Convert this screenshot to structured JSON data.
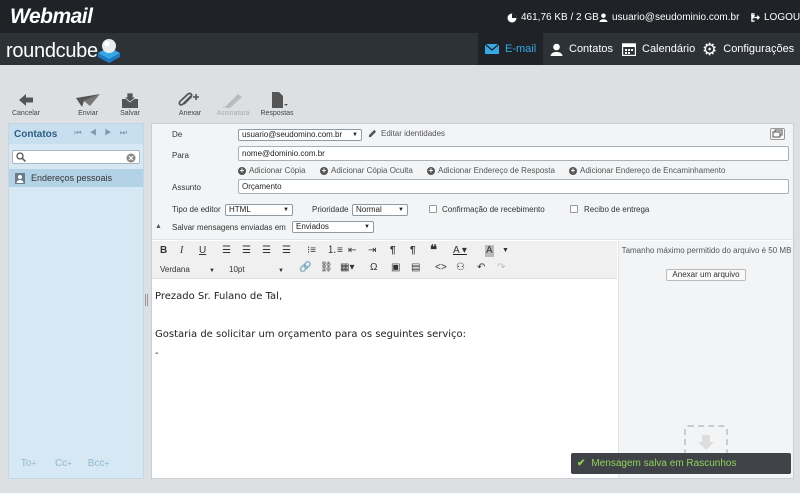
{
  "top": {
    "brand": "Webmail",
    "quota": "461,76 KB / 2 GB",
    "user": "usuario@seudominio.com.br",
    "logout": "LOGOUT"
  },
  "nav": {
    "logo": "roundcube",
    "items": [
      {
        "label": "E-mail",
        "icon": "envelope-icon",
        "active": true
      },
      {
        "label": "Contatos",
        "icon": "person-icon"
      },
      {
        "label": "Calendário",
        "icon": "calendar-icon"
      },
      {
        "label": "Configurações",
        "icon": "gear-icon"
      }
    ]
  },
  "toolbar": {
    "cancel": "Cancelar",
    "send": "Enviar",
    "save": "Salvar",
    "attach": "Anexar",
    "signature": "Assinatura",
    "responses": "Respostas"
  },
  "contacts": {
    "title": "Contatos",
    "item": "Endereços pessoais",
    "to": "To",
    "cc": "Cc",
    "bcc": "Bcc"
  },
  "compose": {
    "from_label": "De",
    "from_value": "usuario@seudomino.com.br",
    "edit_identities": "Editar identidades",
    "to_label": "Para",
    "to_value": "nome@dominio.com.br",
    "add_cc": "Adicionar Cópia",
    "add_bcc": "Adicionar Cópia Oculta",
    "add_reply": "Adicionar Endereço de Resposta",
    "add_followup": "Adicionar Endereço de Encaminhamento",
    "subject_label": "Assunto",
    "subject_value": "Orçamento",
    "editor_type_label": "Tipo de editor",
    "editor_type_value": "HTML",
    "priority_label": "Prioridade",
    "priority_value": "Normal",
    "receipt": "Confirmação de recebimento",
    "dsn": "Recibo de entrega",
    "save_sent_label": "Salvar mensagens enviadas em",
    "save_sent_value": "Enviados"
  },
  "editor": {
    "font": "Verdana",
    "size": "10pt",
    "body": [
      "Prezado Sr. Fulano de Tal,",
      "",
      "Gostaria de solicitar um orçamento para os seguintes serviço:",
      "-"
    ]
  },
  "attachments": {
    "info": "Tamanho máximo permitido do arquivo é 50 MB",
    "button": "Anexar um arquivo"
  },
  "toast": "Mensagem salva em Rascunhos",
  "colors": {
    "accent": "#37a8e6",
    "toast_text": "#8fd35c"
  }
}
